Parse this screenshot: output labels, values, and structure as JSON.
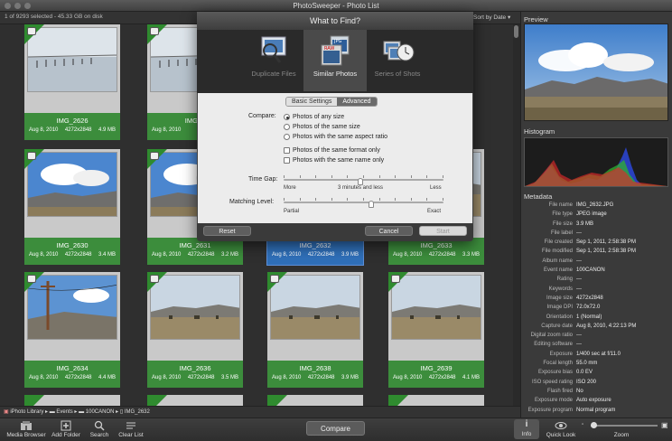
{
  "window": {
    "title": "PhotoSweeper - Photo List"
  },
  "subbar": {
    "file_count": "1 of 9293 selected - 45.33 GB on disk",
    "sort": "Sort by Date"
  },
  "photos": [
    {
      "name": "IMG_2626",
      "date": "Aug 8, 2010",
      "dims": "4272x2848",
      "size": "4.9 MB"
    },
    {
      "name": "IMG_2",
      "date": "Aug 8, 2010",
      "dims": "",
      "size": ""
    },
    {
      "name": "",
      "date": "",
      "dims": "",
      "size": ""
    },
    {
      "name": "",
      "date": "",
      "dims": "",
      "size": ""
    },
    {
      "name": "IMG_2630",
      "date": "Aug 8, 2010",
      "dims": "4272x2848",
      "size": "3.4 MB"
    },
    {
      "name": "IMG_2631",
      "date": "Aug 8, 2010",
      "dims": "4272x2848",
      "size": "3.2 MB"
    },
    {
      "name": "IMG_2632",
      "date": "Aug 8, 2010",
      "dims": "4272x2848",
      "size": "3.9 MB"
    },
    {
      "name": "IMG_2633",
      "date": "Aug 8, 2010",
      "dims": "4272x2848",
      "size": "3.3 MB"
    },
    {
      "name": "IMG_2634",
      "date": "Aug 8, 2010",
      "dims": "4272x2848",
      "size": "4.4 MB"
    },
    {
      "name": "IMG_2636",
      "date": "Aug 8, 2010",
      "dims": "4272x2848",
      "size": "3.5 MB"
    },
    {
      "name": "IMG_2638",
      "date": "Aug 8, 2010",
      "dims": "4272x2848",
      "size": "3.9 MB"
    },
    {
      "name": "IMG_2639",
      "date": "Aug 8, 2010",
      "dims": "4272x2848",
      "size": "4.1 MB"
    }
  ],
  "dialog": {
    "title": "What to Find?",
    "modes": [
      "Duplicate Files",
      "Similar Photos",
      "Series of Shots"
    ],
    "mode_icon_tags": [
      "JPG",
      "RAW"
    ],
    "tabs": [
      "Basic Settings",
      "Advanced"
    ],
    "compare_label": "Compare:",
    "radios": [
      "Photos of any size",
      "Photos of the same size",
      "Photos with the same aspect ratio"
    ],
    "checks": [
      "Photos of the same format only",
      "Photos with the same name only"
    ],
    "time_gap_label": "Time Gap:",
    "time_gap_min": "More",
    "time_gap_value": "3 minutes and less",
    "time_gap_max": "Less",
    "time_gap_level": 0.48,
    "match_label": "Matching Level:",
    "match_min": "Partial",
    "match_max": "Exact",
    "match_level": 0.55,
    "reset": "Reset",
    "cancel": "Cancel",
    "start": "Start"
  },
  "right": {
    "preview_title": "Preview",
    "histogram_title": "Histogram",
    "metadata_title": "Metadata",
    "metadata": [
      [
        "File name",
        "IMG_2632.JPG"
      ],
      [
        "File type",
        "JPEG image"
      ],
      [
        "File size",
        "3.9 MB"
      ],
      [
        "File label",
        "---"
      ],
      [
        "File created",
        "Sep 1, 2011, 2:58:38 PM"
      ],
      [
        "File modified",
        "Sep 1, 2011, 2:58:38 PM"
      ],
      [
        "Album name",
        "---"
      ],
      [
        "Event name",
        "100CANON"
      ],
      [
        "Rating",
        "---"
      ],
      [
        "Keywords",
        "---"
      ],
      [
        "Image size",
        "4272x2848"
      ],
      [
        "Image DPI",
        "72.0x72.0"
      ],
      [
        "Orientation",
        "1 (Normal)"
      ],
      [
        "Capture date",
        "Aug 8, 2010, 4:22:13 PM"
      ],
      [
        "Digital zoom ratio",
        "---"
      ],
      [
        "Editing software",
        "---"
      ],
      [
        "Exposure",
        "1/400 sec at f/11.0"
      ],
      [
        "Focal length",
        "55.0 mm"
      ],
      [
        "Exposure bias",
        "0.0 EV"
      ],
      [
        "ISO speed rating",
        "ISO 200"
      ],
      [
        "Flash fired",
        "No"
      ],
      [
        "Exposure mode",
        "Auto exposure"
      ],
      [
        "Exposure program",
        "Normal program"
      ]
    ]
  },
  "pathbar": {
    "items": [
      "iPhoto Library",
      "Events",
      "100CANON",
      "IMG_2632"
    ]
  },
  "toolbar": {
    "media_browser": "Media Browser",
    "add_folder": "Add Folder",
    "search": "Search",
    "clear_list": "Clear List",
    "compare": "Compare",
    "info": "Info",
    "quick_look": "Quick Look",
    "zoom": "Zoom"
  },
  "colors": {
    "green": "#3c8d3c",
    "selection": "#2f6fb8"
  }
}
